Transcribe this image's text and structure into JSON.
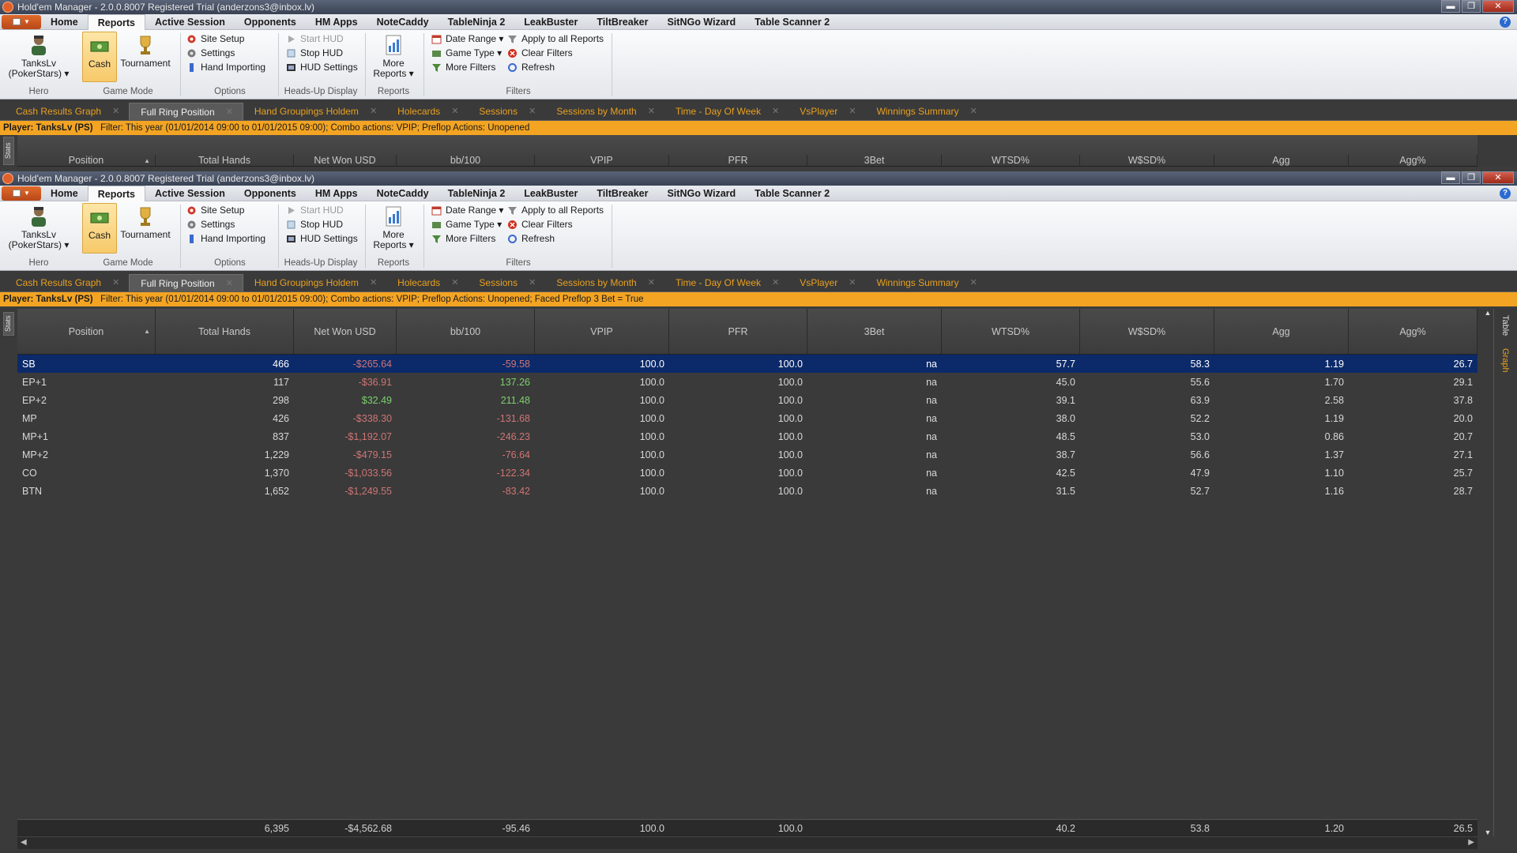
{
  "window1": {
    "title": "Hold'em Manager - 2.0.0.8007 Registered Trial (anderzons3@inbox.lv)",
    "filter_player": "Player: TanksLv (PS)",
    "filter_text": "Filter: This year (01/01/2014 09:00 to 01/01/2015 09:00); Combo actions: VPIP; Preflop Actions: Unopened",
    "partial_headers": [
      "Position",
      "Total Hands",
      "Net Won USD",
      "bb/100",
      "VPIP",
      "PFR",
      "3Bet",
      "WTSD%",
      "W$SD%",
      "Agg",
      "Agg%"
    ]
  },
  "window2": {
    "title": "Hold'em Manager - 2.0.0.8007 Registered Trial (anderzons3@inbox.lv)",
    "filter_player": "Player: TanksLv (PS)",
    "filter_text": "Filter: This year (01/01/2014 09:00 to 01/01/2015 09:00); Combo actions: VPIP; Preflop Actions: Unopened; Faced Preflop 3 Bet = True"
  },
  "window_buttons": {
    "minimize": "▬",
    "restore": "❐",
    "close": "✕"
  },
  "menu": [
    "Home",
    "Reports",
    "Active Session",
    "Opponents",
    "HM Apps",
    "NoteCaddy",
    "TableNinja 2",
    "LeakBuster",
    "TiltBreaker",
    "SitNGo Wizard",
    "Table Scanner 2"
  ],
  "menu_active": "Reports",
  "ribbon": {
    "hero_name": "TanksLv",
    "hero_site": "(PokerStars) ▾",
    "cash": "Cash",
    "tournament": "Tournament",
    "site_setup": "Site Setup",
    "settings": "Settings",
    "hand_importing": "Hand Importing",
    "start_hud": "Start HUD",
    "stop_hud": "Stop HUD",
    "hud_settings": "HUD Settings",
    "more_reports_1": "More",
    "more_reports_2": "Reports ▾",
    "date_range": "Date Range ▾",
    "game_type": "Game Type ▾",
    "more_filters": "More Filters",
    "apply_all": "Apply to all Reports",
    "clear_filters": "Clear Filters",
    "refresh": "Refresh",
    "groups": {
      "hero": "Hero",
      "game_mode": "Game Mode",
      "options": "Options",
      "hud": "Heads-Up Display",
      "reports": "Reports",
      "filters": "Filters"
    }
  },
  "report_tabs": [
    "Cash Results Graph",
    "Full Ring Position",
    "Hand Groupings Holdem",
    "Holecards",
    "Sessions",
    "Sessions by Month",
    "Time - Day Of Week",
    "VsPlayer",
    "Winnings Summary"
  ],
  "active_tab": "Full Ring Position",
  "tab_close": "✕",
  "stats_label": "Stats",
  "side_tabs": {
    "table": "Table",
    "graph": "Graph"
  },
  "columns": [
    "Position",
    "Total Hands",
    "Net Won USD",
    "bb/100",
    "VPIP",
    "PFR",
    "3Bet",
    "WTSD%",
    "W$SD%",
    "Agg",
    "Agg%"
  ],
  "sort_indicator": "▲",
  "rows": [
    {
      "position": "SB",
      "hands": "466",
      "net": "-$265.64",
      "bb100": "-59.58",
      "vpip": "100.0",
      "pfr": "100.0",
      "threebet": "na",
      "wtsd": "57.7",
      "wsd": "58.3",
      "agg": "1.19",
      "aggp": "26.7"
    },
    {
      "position": "EP+1",
      "hands": "117",
      "net": "-$36.91",
      "bb100": "137.26",
      "vpip": "100.0",
      "pfr": "100.0",
      "threebet": "na",
      "wtsd": "45.0",
      "wsd": "55.6",
      "agg": "1.70",
      "aggp": "29.1"
    },
    {
      "position": "EP+2",
      "hands": "298",
      "net": "$32.49",
      "bb100": "211.48",
      "vpip": "100.0",
      "pfr": "100.0",
      "threebet": "na",
      "wtsd": "39.1",
      "wsd": "63.9",
      "agg": "2.58",
      "aggp": "37.8"
    },
    {
      "position": "MP",
      "hands": "426",
      "net": "-$338.30",
      "bb100": "-131.68",
      "vpip": "100.0",
      "pfr": "100.0",
      "threebet": "na",
      "wtsd": "38.0",
      "wsd": "52.2",
      "agg": "1.19",
      "aggp": "20.0"
    },
    {
      "position": "MP+1",
      "hands": "837",
      "net": "-$1,192.07",
      "bb100": "-246.23",
      "vpip": "100.0",
      "pfr": "100.0",
      "threebet": "na",
      "wtsd": "48.5",
      "wsd": "53.0",
      "agg": "0.86",
      "aggp": "20.7"
    },
    {
      "position": "MP+2",
      "hands": "1,229",
      "net": "-$479.15",
      "bb100": "-76.64",
      "vpip": "100.0",
      "pfr": "100.0",
      "threebet": "na",
      "wtsd": "38.7",
      "wsd": "56.6",
      "agg": "1.37",
      "aggp": "27.1"
    },
    {
      "position": "CO",
      "hands": "1,370",
      "net": "-$1,033.56",
      "bb100": "-122.34",
      "vpip": "100.0",
      "pfr": "100.0",
      "threebet": "na",
      "wtsd": "42.5",
      "wsd": "47.9",
      "agg": "1.10",
      "aggp": "25.7"
    },
    {
      "position": "BTN",
      "hands": "1,652",
      "net": "-$1,249.55",
      "bb100": "-83.42",
      "vpip": "100.0",
      "pfr": "100.0",
      "threebet": "na",
      "wtsd": "31.5",
      "wsd": "52.7",
      "agg": "1.16",
      "aggp": "28.7"
    }
  ],
  "totals": {
    "position": "",
    "hands": "6,395",
    "net": "-$4,562.68",
    "bb100": "-95.46",
    "vpip": "100.0",
    "pfr": "100.0",
    "threebet": "",
    "wtsd": "40.2",
    "wsd": "53.8",
    "agg": "1.20",
    "aggp": "26.5"
  },
  "colors": {
    "accent": "#f3a423",
    "selected_row": "#0c2a6a",
    "negative": "#d07474",
    "positive": "#7cd06c"
  }
}
